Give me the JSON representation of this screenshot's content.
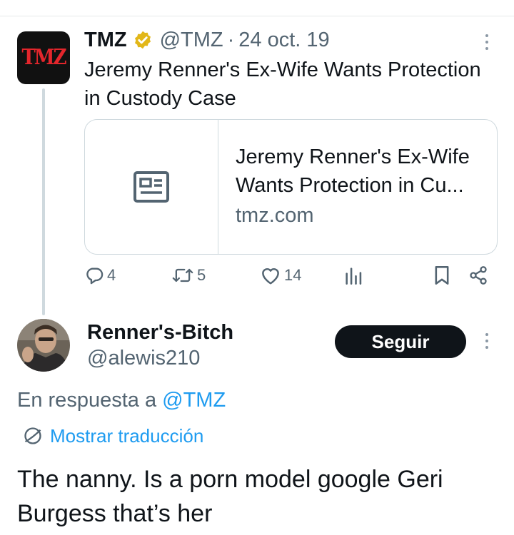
{
  "parent_tweet": {
    "avatar_text": "TMZ",
    "name": "TMZ",
    "handle": "@TMZ",
    "separator": "·",
    "date": "24 oct. 19",
    "text": "Jeremy Renner's Ex-Wife Wants Protection in Custody Case",
    "card": {
      "title": "Jeremy Renner's Ex-Wife Wants Protection in Cu...",
      "domain": "tmz.com",
      "icon": "article-icon"
    },
    "actions": {
      "replies": "4",
      "retweets": "5",
      "likes": "14"
    }
  },
  "reply_tweet": {
    "name": "Renner's-Bitch",
    "handle": "@alewis210",
    "follow_label": "Seguir",
    "in_reply_prefix": "En respuesta a",
    "in_reply_mention": "@TMZ",
    "translate_label": "Mostrar traducción",
    "text": "The nanny. Is a porn model google Geri Burgess that’s her"
  },
  "colors": {
    "accent": "#1d9bf0",
    "text_primary": "#0f1419",
    "text_secondary": "#536471",
    "border": "#cfd9de",
    "verified_gold": "#e2b719",
    "tmz_red": "#e3262c"
  }
}
